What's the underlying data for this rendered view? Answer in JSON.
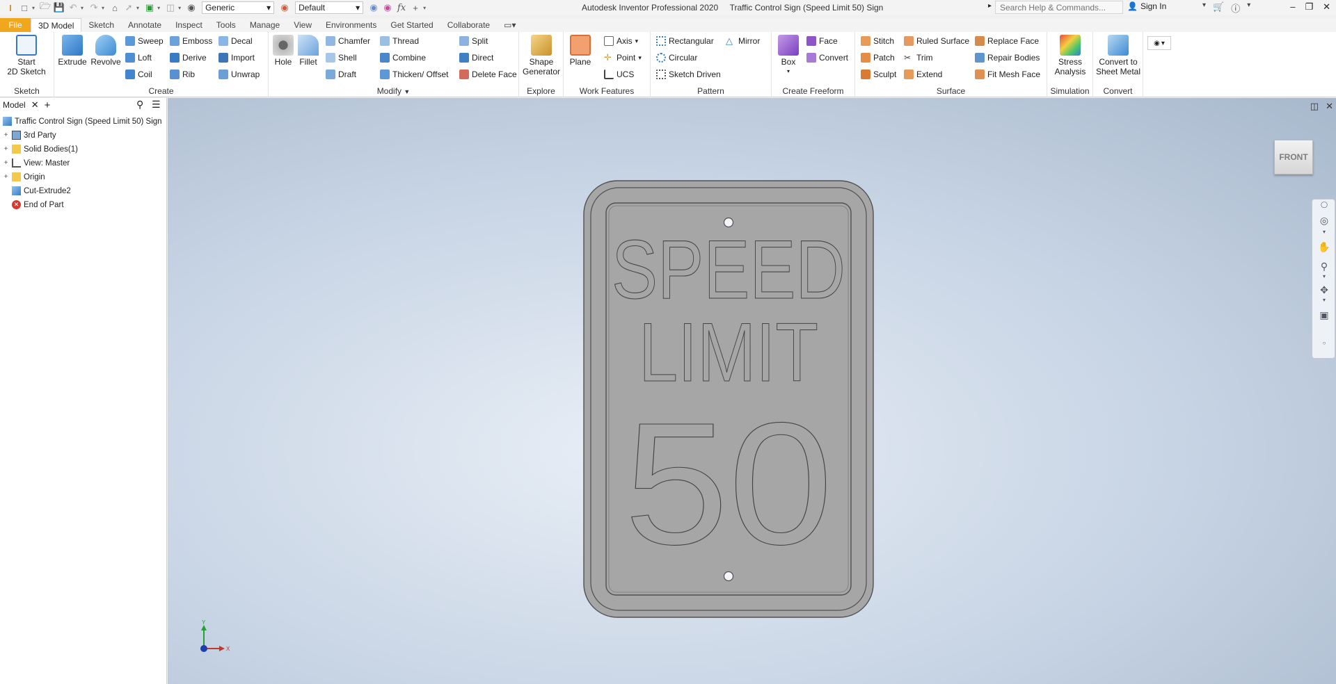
{
  "titlebar": {
    "app_title": "Autodesk Inventor Professional 2020",
    "doc_title": "Traffic Control Sign (Speed Limit 50) Sign",
    "search_placeholder": "Search Help & Commands...",
    "signin_label": "Sign In",
    "material_dropdown": "Generic",
    "appearance_dropdown": "Default",
    "fx_label": "fx"
  },
  "tabs": [
    "File",
    "3D Model",
    "Sketch",
    "Annotate",
    "Inspect",
    "Tools",
    "Manage",
    "View",
    "Environments",
    "Get Started",
    "Collaborate"
  ],
  "active_tab": "3D Model",
  "ribbon": {
    "sketch": {
      "label": "Sketch",
      "start_sketch": "Start\n2D Sketch"
    },
    "create": {
      "label": "Create",
      "extrude": "Extrude",
      "revolve": "Revolve",
      "sweep": "Sweep",
      "loft": "Loft",
      "coil": "Coil",
      "emboss": "Emboss",
      "derive": "Derive",
      "rib": "Rib",
      "decal": "Decal",
      "import": "Import",
      "unwrap": "Unwrap"
    },
    "modify": {
      "label": "Modify",
      "hole": "Hole",
      "fillet": "Fillet",
      "chamfer": "Chamfer",
      "shell": "Shell",
      "draft": "Draft",
      "thread": "Thread",
      "combine": "Combine",
      "thicken": "Thicken/ Offset",
      "split": "Split",
      "direct": "Direct",
      "delete_face": "Delete Face"
    },
    "explore": {
      "label": "Explore",
      "shape_generator": "Shape\nGenerator"
    },
    "work_features": {
      "label": "Work Features",
      "plane": "Plane",
      "axis": "Axis",
      "point": "Point",
      "ucs": "UCS"
    },
    "pattern": {
      "label": "Pattern",
      "rectangular": "Rectangular",
      "circular": "Circular",
      "sketch_driven": "Sketch Driven",
      "mirror": "Mirror"
    },
    "freeform": {
      "label": "Create Freeform",
      "box": "Box",
      "face": "Face",
      "convert": "Convert"
    },
    "surface": {
      "label": "Surface",
      "stitch": "Stitch",
      "patch": "Patch",
      "sculpt": "Sculpt",
      "ruled_surface": "Ruled Surface",
      "trim": "Trim",
      "extend": "Extend",
      "replace_face": "Replace Face",
      "repair_bodies": "Repair Bodies",
      "fit_mesh_face": "Fit Mesh Face"
    },
    "simulation": {
      "label": "Simulation",
      "stress_analysis": "Stress\nAnalysis"
    },
    "convert": {
      "label": "Convert",
      "sheet_metal": "Convert to\nSheet Metal"
    }
  },
  "browser": {
    "tab_label": "Model",
    "root": "Traffic Control Sign (Speed Limit 50) Sign",
    "items": [
      "3rd Party",
      "Solid Bodies(1)",
      "View: Master",
      "Origin",
      "Cut-Extrude2",
      "End of Part"
    ]
  },
  "viewport": {
    "viewcube_label": "FRONT",
    "sign_line1": "SPEED",
    "sign_line2": "LIMIT",
    "sign_number": "50",
    "axis_x": "X",
    "axis_y": "Y"
  },
  "colors": {
    "file_tab": "#f0a61d",
    "sign_face": "#a6a6a6",
    "sign_outline": "#505050"
  }
}
